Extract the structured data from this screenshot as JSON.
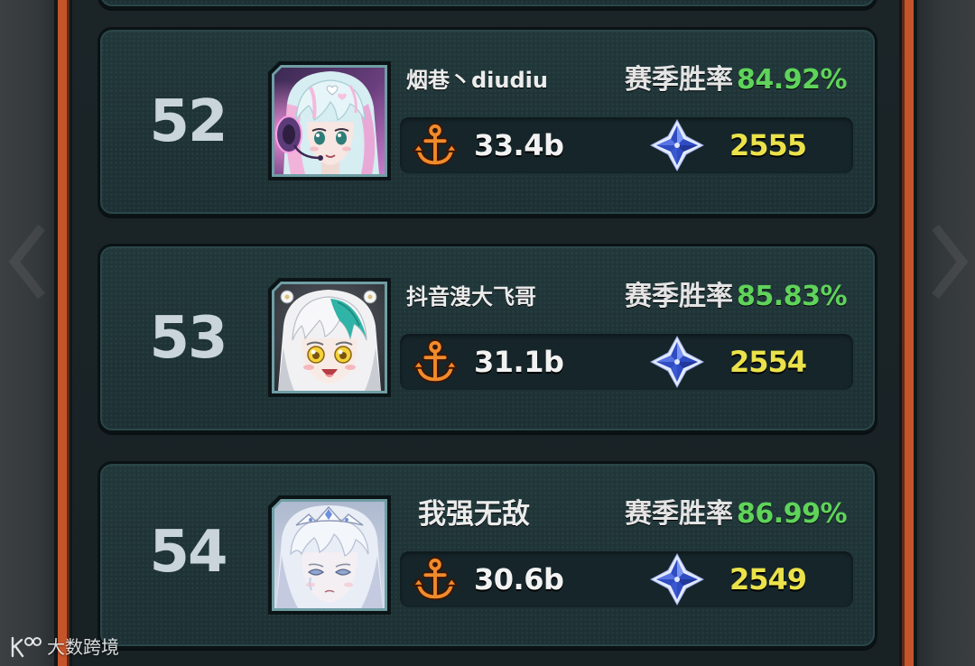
{
  "leaderboard": {
    "rows": [
      {
        "rank": "52",
        "name": "烟巷丶diudiu",
        "win_rate_label": "赛季胜率",
        "win_rate": "84.92%",
        "power": "33.4b",
        "score": "2555",
        "avatar_icon": "pink-haired-girl-avatar-icon"
      },
      {
        "rank": "53",
        "name": "抖音溲大飞哥",
        "win_rate_label": "赛季胜率",
        "win_rate": "85.83%",
        "power": "31.1b",
        "score": "2554",
        "avatar_icon": "white-teal-haired-girl-avatar-icon"
      },
      {
        "rank": "54",
        "name": "我强无敌",
        "win_rate_label": "赛季胜率",
        "win_rate": "86.99%",
        "power": "30.6b",
        "score": "2549",
        "avatar_icon": "silver-haired-tiara-girl-avatar-icon"
      }
    ]
  },
  "icons": {
    "power": "anchor-icon",
    "score": "diamond-icon"
  },
  "watermark": {
    "text": "大数跨境",
    "logo": "watermark-logo-icon"
  },
  "colors": {
    "frame_orange": "#c4552a",
    "win_rate_green": "#5fd35a",
    "score_yellow": "#ebe24a",
    "power_icon_orange": "#f08b2c",
    "diamond_blue": "#2f4cc2",
    "rank_gray": "#c9d5da"
  }
}
